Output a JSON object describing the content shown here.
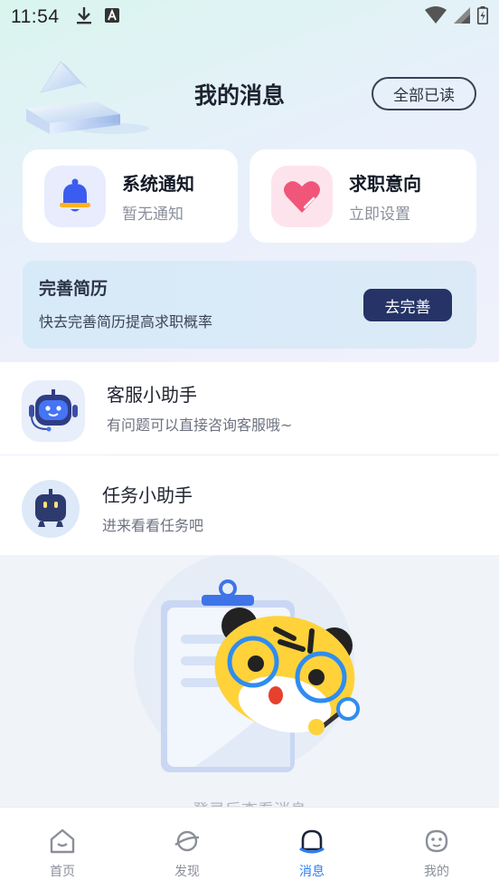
{
  "status_bar": {
    "time": "11:54",
    "icons_left": [
      "download-icon",
      "a-badge-icon"
    ],
    "icons_right": [
      "wifi-icon",
      "signal-icon",
      "battery-icon"
    ]
  },
  "header": {
    "title": "我的消息",
    "read_all_label": "全部已读"
  },
  "cards": [
    {
      "title": "系统通知",
      "subtitle": "暂无通知",
      "icon": "bell-icon",
      "color": "#3b5cf0"
    },
    {
      "title": "求职意向",
      "subtitle": "立即设置",
      "icon": "heart-icon",
      "color": "#f0567a"
    }
  ],
  "resume_banner": {
    "title": "完善简历",
    "subtitle": "快去完善简历提高求职概率",
    "button_label": "去完善"
  },
  "assistants": [
    {
      "title": "客服小助手",
      "subtitle": "有问题可以直接咨询客服哦~",
      "icon": "robot-headset-icon"
    },
    {
      "title": "任务小助手",
      "subtitle": "进来看看任务吧",
      "icon": "robot-icon"
    }
  ],
  "empty_state": {
    "text": "登录后查看消息"
  },
  "tab_bar": {
    "tabs": [
      {
        "label": "首页",
        "icon": "home-icon"
      },
      {
        "label": "发现",
        "icon": "planet-icon"
      },
      {
        "label": "消息",
        "icon": "message-icon"
      },
      {
        "label": "我的",
        "icon": "face-icon"
      }
    ],
    "active": "消息"
  },
  "colors": {
    "accent": "#2d7cf6",
    "primary_button": "#253366",
    "banner_bg": "#d7eaf8"
  }
}
